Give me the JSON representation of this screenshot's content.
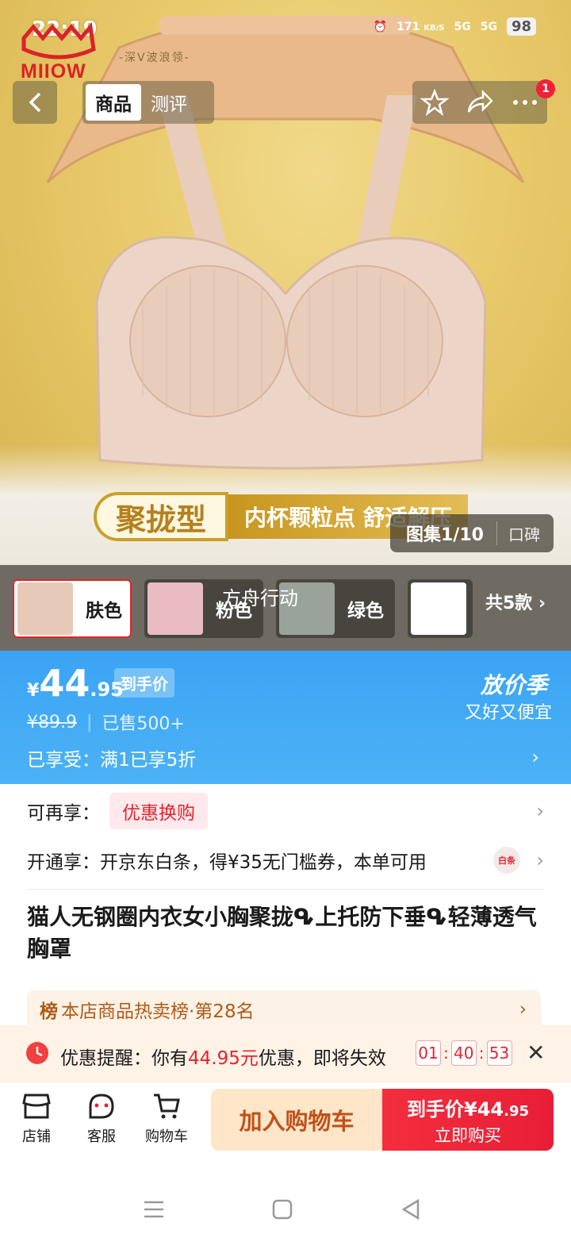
{
  "status_bar": {
    "time": "22:19",
    "network_speed": "171",
    "network_unit": "KB/S",
    "signal_1": "5G",
    "signal_2": "5G",
    "battery": "98"
  },
  "brand": {
    "logo_text": "MIIOW",
    "sub_text": "-深V波浪领-"
  },
  "nav": {
    "tabs": [
      {
        "label": "商品",
        "active": true
      },
      {
        "label": "测评",
        "active": false
      }
    ],
    "badge": "1"
  },
  "hero": {
    "promo_main": "聚拢型",
    "promo_sub": "内杯颗粒点 舒适解压",
    "gallery_count": "图集1/10",
    "gallery_alt": "口碑",
    "overlay_text": "方舟行动"
  },
  "variants": {
    "items": [
      {
        "label": "肤色",
        "selected": true,
        "color": "#e7c9b8"
      },
      {
        "label": "粉色",
        "selected": false,
        "color": "#e9bcc2"
      },
      {
        "label": "绿色",
        "selected": false,
        "color": "#9aa39a"
      },
      {
        "label": "",
        "selected": false,
        "color": "#ffffff"
      }
    ],
    "more": "共5款 ›"
  },
  "price": {
    "yen": "¥",
    "integer": "44",
    "decimal": ".95",
    "tag": "到手价",
    "old_price": "¥89.9",
    "sold": "已售500+",
    "season_title": "放价季",
    "season_sub": "又好又便宜",
    "enjoy": "已享受：满1已享5折",
    "arrow": "›"
  },
  "offers": {
    "row1_label": "可再享：",
    "row1_chip": "优惠换购",
    "row2_text": "开通享：开京东白条，得¥35无门槛券，本单可用",
    "row2_icon": "白条"
  },
  "product": {
    "title": "猫人无钢圈内衣女小胸聚拢ᕴ上托防下垂ᕴ轻薄透气胸罩",
    "rank_icon": "榜",
    "rank_text": "本店商品热卖榜·第28名"
  },
  "reminder": {
    "prefix": "优惠提醒：你有",
    "amount": "44.95元",
    "suffix": "优惠，即将失效",
    "hours": "01",
    "minutes": "40",
    "seconds": "53"
  },
  "bottom_bar": {
    "shop": "店铺",
    "service": "客服",
    "cart": "购物车",
    "add_cart": "加入购物车",
    "buy_price_label": "到手价¥44",
    "buy_price_dec": ".95",
    "buy_now": "立即购买"
  },
  "colors": {
    "accent_blue": "#3aa4f4",
    "accent_red": "#e81e36",
    "cart_bg": "#ffe6c8"
  }
}
